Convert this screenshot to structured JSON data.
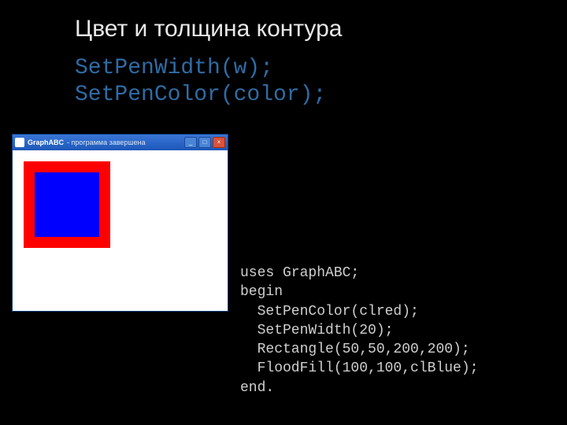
{
  "title": "Цвет и толщина контура",
  "api": {
    "line1": "SetPenWidth(w);",
    "line2": "SetPenColor(color);"
  },
  "window": {
    "app_name": "GraphABC",
    "status": "- программа завершена",
    "min_glyph": "_",
    "max_glyph": "□",
    "close_glyph": "×"
  },
  "code": {
    "l1": "uses GraphABC;",
    "l2": "begin",
    "l3": "  SetPenColor(clred);",
    "l4": "  SetPenWidth(20);",
    "l5": "  Rectangle(50,50,200,200);",
    "l6": "  FloodFill(100,100,clBlue);",
    "l7": "end."
  }
}
